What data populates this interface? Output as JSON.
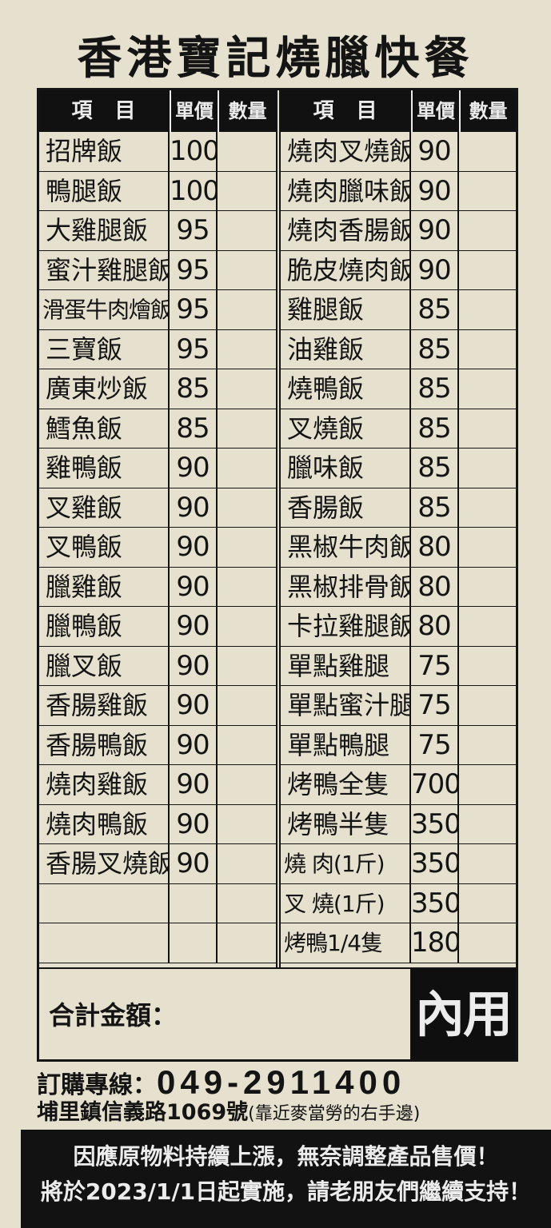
{
  "title": "香港寶記燒臘快餐",
  "headers": {
    "item": "項目",
    "price": "單價",
    "qty": "數量"
  },
  "left_items": [
    {
      "name": "招牌飯",
      "price": "100"
    },
    {
      "name": "鴨腿飯",
      "price": "100"
    },
    {
      "name": "大雞腿飯",
      "price": "95"
    },
    {
      "name": "蜜汁雞腿飯",
      "price": "95"
    },
    {
      "name": "滑蛋牛肉燴飯",
      "price": "95"
    },
    {
      "name": "三寶飯",
      "price": "95"
    },
    {
      "name": "廣東炒飯",
      "price": "85"
    },
    {
      "name": "鱈魚飯",
      "price": "85"
    },
    {
      "name": "雞鴨飯",
      "price": "90"
    },
    {
      "name": "叉雞飯",
      "price": "90"
    },
    {
      "name": "叉鴨飯",
      "price": "90"
    },
    {
      "name": "臘雞飯",
      "price": "90"
    },
    {
      "name": "臘鴨飯",
      "price": "90"
    },
    {
      "name": "臘叉飯",
      "price": "90"
    },
    {
      "name": "香腸雞飯",
      "price": "90"
    },
    {
      "name": "香腸鴨飯",
      "price": "90"
    },
    {
      "name": "燒肉雞飯",
      "price": "90"
    },
    {
      "name": "燒肉鴨飯",
      "price": "90"
    },
    {
      "name": "香腸叉燒飯",
      "price": "90"
    },
    {
      "name": "",
      "price": ""
    },
    {
      "name": "",
      "price": ""
    }
  ],
  "right_items": [
    {
      "name": "燒肉叉燒飯",
      "price": "90"
    },
    {
      "name": "燒肉臘味飯",
      "price": "90"
    },
    {
      "name": "燒肉香腸飯",
      "price": "90"
    },
    {
      "name": "脆皮燒肉飯",
      "price": "90"
    },
    {
      "name": "雞腿飯",
      "price": "85"
    },
    {
      "name": "油雞飯",
      "price": "85"
    },
    {
      "name": "燒鴨飯",
      "price": "85"
    },
    {
      "name": "叉燒飯",
      "price": "85"
    },
    {
      "name": "臘味飯",
      "price": "85"
    },
    {
      "name": "香腸飯",
      "price": "85"
    },
    {
      "name": "黑椒牛肉飯",
      "price": "80"
    },
    {
      "name": "黑椒排骨飯",
      "price": "80"
    },
    {
      "name": "卡拉雞腿飯",
      "price": "80"
    },
    {
      "name": "單點雞腿",
      "price": "75"
    },
    {
      "name": "單點蜜汁腿",
      "price": "75"
    },
    {
      "name": "單點鴨腿",
      "price": "75"
    },
    {
      "name": "烤鴨全隻",
      "price": "700"
    },
    {
      "name": "烤鴨半隻",
      "price": "350"
    },
    {
      "name": "燒 肉(1斤)",
      "price": "350"
    },
    {
      "name": "叉 燒(1斤)",
      "price": "350"
    },
    {
      "name": "烤鴨1/4隻",
      "price": "180"
    }
  ],
  "total_label": "合計金額：",
  "dine_in": "內用",
  "order_label": "訂購專線：",
  "phone": "049-2911400",
  "address_main": "埔里鎮信義路1069號",
  "address_note": "(靠近麥當勞的右手邊)",
  "notice_line1": "因應原物料持續上漲，無奈調整產品售價！",
  "notice_line2": "將於2023/1/1日起實施，請老朋友們繼續支持！"
}
